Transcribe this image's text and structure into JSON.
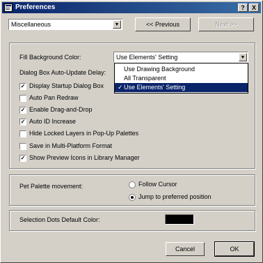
{
  "window": {
    "title": "Preferences",
    "help_button": "?",
    "close_button": "X"
  },
  "top": {
    "category_select": "Miscellaneous",
    "previous_button": "<< Previous",
    "next_button": "Next >>"
  },
  "fill_background": {
    "label": "Fill Background Color:",
    "selected": "Use Elements' Setting",
    "options": [
      {
        "label": "Use Drawing Background",
        "selected": false
      },
      {
        "label": "All Transparent",
        "selected": false
      },
      {
        "label": "Use Elements' Setting",
        "selected": true
      }
    ]
  },
  "autoupdate_label": "Dialog Box Auto-Update Delay:",
  "checkboxes": [
    {
      "label": "Display Startup Dialog Box",
      "checked": true
    },
    {
      "label": "Auto Pan Redraw",
      "checked": false
    },
    {
      "label": "Enable Drag-and-Drop",
      "checked": true
    },
    {
      "label": "Auto ID Increase",
      "checked": true
    },
    {
      "label": "Hide Locked Layers in Pop-Up Palettes",
      "checked": false
    },
    {
      "label": "Save in Multi-Platform Format",
      "checked": false
    },
    {
      "label": "Show Preview Icons in Library Manager",
      "checked": true
    }
  ],
  "palette_movement": {
    "label": "Pet Palette movement:",
    "options": [
      {
        "label": "Follow Cursor",
        "selected": false
      },
      {
        "label": "Jump to preferred position",
        "selected": true
      }
    ]
  },
  "selection_dots": {
    "label": "Selection Dots Default Color:",
    "color": "#000000"
  },
  "footer": {
    "cancel_button": "Cancel",
    "ok_button": "OK"
  },
  "colors": {
    "titlebar_start": "#0a246a",
    "titlebar_end": "#3a6ea5",
    "face": "#d4d0c8",
    "highlight": "#0a246a"
  }
}
